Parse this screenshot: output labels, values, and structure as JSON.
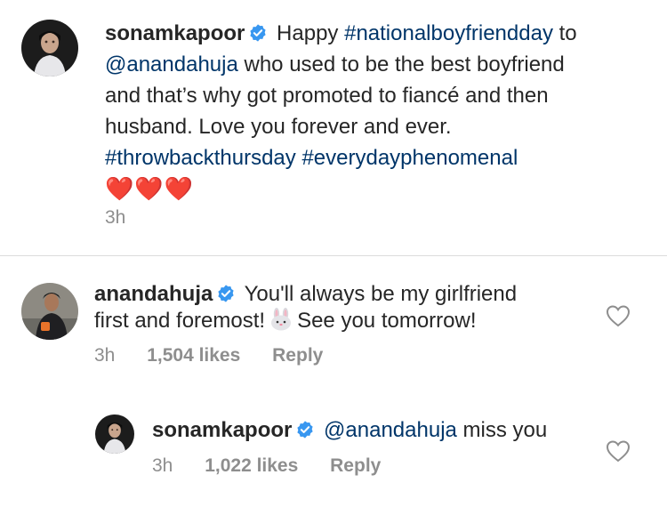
{
  "caption": {
    "username": "sonamkapoor",
    "parts": {
      "p1": "Happy",
      "p2": "#nationalboyfriendday",
      "p3": "to",
      "p4": "@anandahuja",
      "p5": "who used to be the best boyfriend and that’s why got promoted to fiancé and then husband. Love you forever and ever.",
      "p6": "#throwbackthursday",
      "p7": "#everydayphenomenal"
    },
    "emoji": "❤️❤️❤️",
    "time": "3h"
  },
  "comment1": {
    "username": "anandahuja",
    "text_a": "You'll always be my girlfriend first and foremost!",
    "text_b": "See you tomorrow!",
    "time": "3h",
    "likes": "1,504 likes",
    "reply": "Reply"
  },
  "comment2": {
    "username": "sonamkapoor",
    "mention": "@anandahuja",
    "text": "miss you",
    "time": "3h",
    "likes": "1,022 likes",
    "reply": "Reply"
  },
  "icons": {
    "verified": "verified-badge-icon",
    "like": "heart-outline-icon",
    "bunny": "rabbit-face-emoji"
  },
  "colors": {
    "link": "#003569",
    "verified": "#3897f0",
    "meta": "#8e8e8e",
    "divider": "#dbdbdb"
  }
}
